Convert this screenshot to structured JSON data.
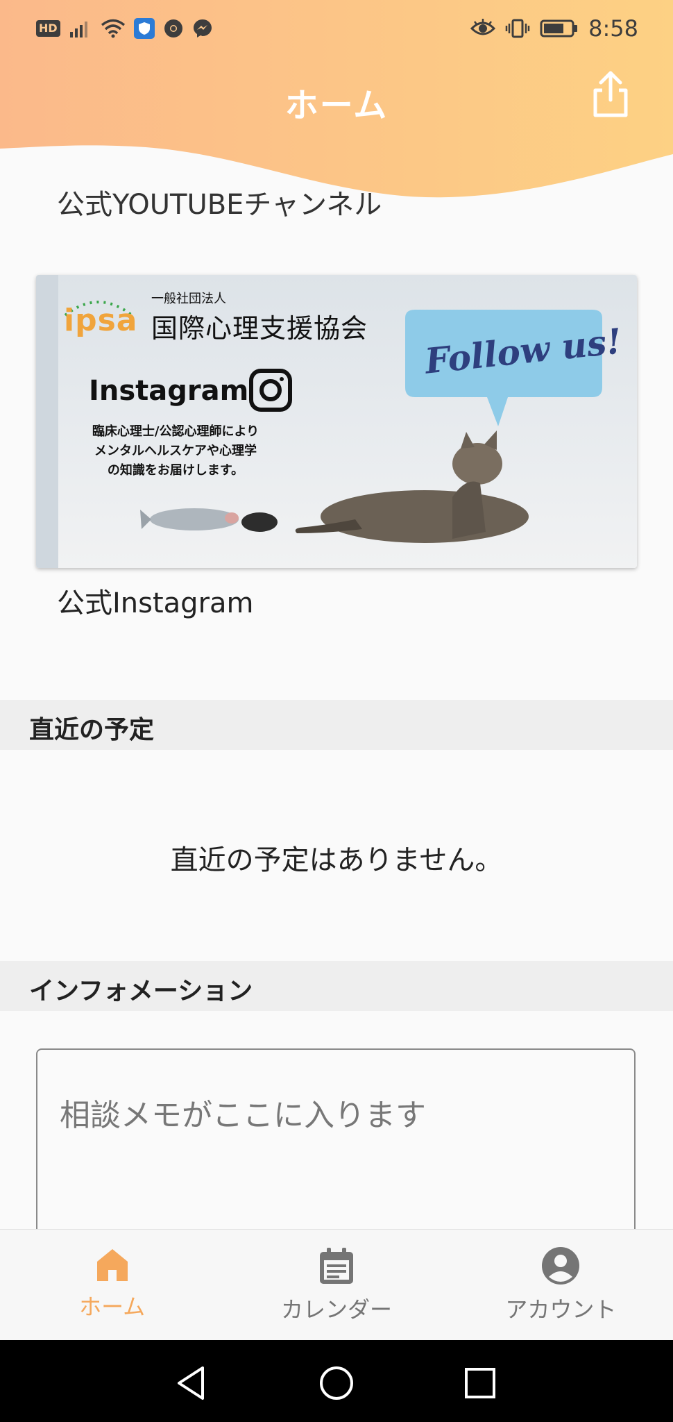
{
  "status_bar": {
    "hd_badge": "HD",
    "time": "8:58",
    "left_icons": [
      "signal-icon",
      "wifi-icon",
      "shield-app-icon",
      "chrome-icon",
      "messenger-icon"
    ],
    "right_icons": [
      "eye-icon",
      "vibrate-icon",
      "battery-icon"
    ]
  },
  "header": {
    "title": "ホーム",
    "share_icon": "share-icon",
    "gradient_colors": [
      "#fbb98a",
      "#fdd184"
    ]
  },
  "content": {
    "partial_label": "公式YOUTUBEチャンネル",
    "banner": {
      "org_prefix": "一般社団法人",
      "org_name": "国際心理支援協会",
      "logo_text": "ipsa",
      "instagram_text": "Instagram",
      "follow_text": "Follow us!",
      "description_lines": [
        "臨床心理士/公認心理師により",
        "メンタルヘルスケアや心理学",
        "の知識をお届けします。"
      ]
    },
    "banner_caption": "公式Instagram"
  },
  "sections": {
    "upcoming_title": "直近の予定",
    "upcoming_empty": "直近の予定はありません。",
    "info_title": "インフォメーション",
    "memo_placeholder": "相談メモがここに入ります"
  },
  "bottom_nav": {
    "items": [
      {
        "label": "ホーム",
        "icon": "home-icon",
        "active": true
      },
      {
        "label": "カレンダー",
        "icon": "calendar-icon",
        "active": false
      },
      {
        "label": "アカウント",
        "icon": "account-icon",
        "active": false
      }
    ],
    "active_color": "#f5a85c",
    "inactive_color": "#757575"
  },
  "system_nav": {
    "icons": [
      "back-icon",
      "home-circle-icon",
      "recents-icon"
    ]
  }
}
